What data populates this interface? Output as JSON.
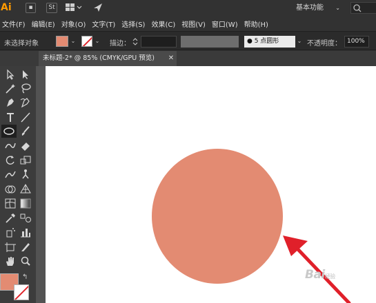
{
  "app": {
    "logo": "Ai",
    "workspace": "基本功能",
    "icons": [
      "bridge-icon",
      "stock-icon",
      "layout-icon",
      "send-icon"
    ],
    "stock_label": "St"
  },
  "menu": [
    "文件(F)",
    "编辑(E)",
    "对象(O)",
    "文字(T)",
    "选择(S)",
    "效果(C)",
    "视图(V)",
    "窗口(W)",
    "帮助(H)"
  ],
  "control": {
    "no_selection": "未选择对象",
    "stroke_label": "描边：",
    "brush": "● 5 点圆形",
    "opacity_label": "不透明度：",
    "opacity_value": "100%"
  },
  "document": {
    "tab_title": "未标题-2* @ 85% (CMYK/GPU 预览)",
    "close": "✕"
  },
  "colors": {
    "fill": "#e38b72",
    "stroke": "none",
    "arrow": "#e0202a",
    "accent": "#ff9a00"
  },
  "canvas": {
    "shape": "circle",
    "watermark": "Bai",
    "watermark_sub": "经验"
  }
}
